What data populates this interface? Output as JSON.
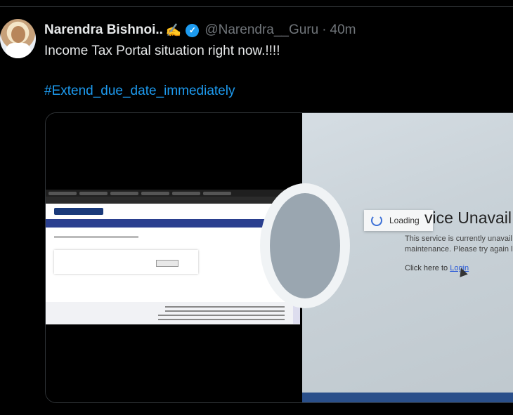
{
  "author": {
    "display_name": "Narendra Bishnoi..",
    "emoji": "✍️",
    "handle": "@Narendra__Guru",
    "separator": "·",
    "time": "40m"
  },
  "tweet": {
    "text": "Income Tax Portal situation right now.!!!!",
    "hashtag": "#Extend_due_date_immediately"
  },
  "media": {
    "loading_label": "Loading",
    "service_title": "vice Unavail",
    "service_line_1": "This service is currently unavail la",
    "service_line_2": "maintenance. Please try again la",
    "link_prefix": "Click here to ",
    "link_text": "Login"
  },
  "icons": {
    "verified": "verified-badge-icon",
    "spinner": "loading-spinner-icon"
  },
  "colors": {
    "background": "#000000",
    "link": "#1d9bf0",
    "secondary_text": "#71767b",
    "verified": "#1d9bf0"
  }
}
